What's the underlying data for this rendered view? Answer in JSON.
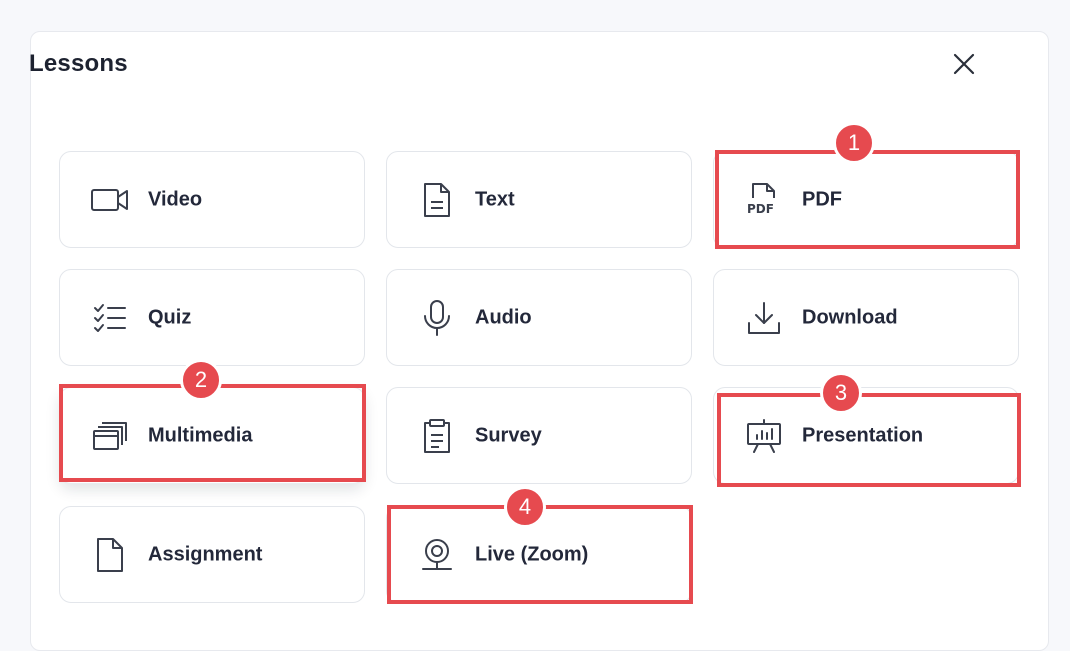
{
  "modal": {
    "title": "Lessons",
    "close_icon": "close-icon"
  },
  "lesson_types": [
    {
      "label": "Video",
      "icon": "video-camera-icon"
    },
    {
      "label": "Text",
      "icon": "text-document-icon"
    },
    {
      "label": "PDF",
      "icon": "pdf-file-icon"
    },
    {
      "label": "Quiz",
      "icon": "checklist-icon"
    },
    {
      "label": "Audio",
      "icon": "microphone-icon"
    },
    {
      "label": "Download",
      "icon": "download-icon"
    },
    {
      "label": "Multimedia",
      "icon": "stacked-windows-icon"
    },
    {
      "label": "Survey",
      "icon": "clipboard-icon"
    },
    {
      "label": "Presentation",
      "icon": "presentation-board-icon"
    },
    {
      "label": "Assignment",
      "icon": "blank-file-icon"
    },
    {
      "label": "Live (Zoom)",
      "icon": "webcam-icon"
    }
  ],
  "annotations": [
    {
      "number": "1",
      "target": "PDF"
    },
    {
      "number": "2",
      "target": "Multimedia"
    },
    {
      "number": "3",
      "target": "Presentation"
    },
    {
      "number": "4",
      "target": "Live (Zoom)"
    }
  ],
  "colors": {
    "highlight": "#e64a4f",
    "text": "#23283a",
    "icon": "#3a3f4c"
  }
}
